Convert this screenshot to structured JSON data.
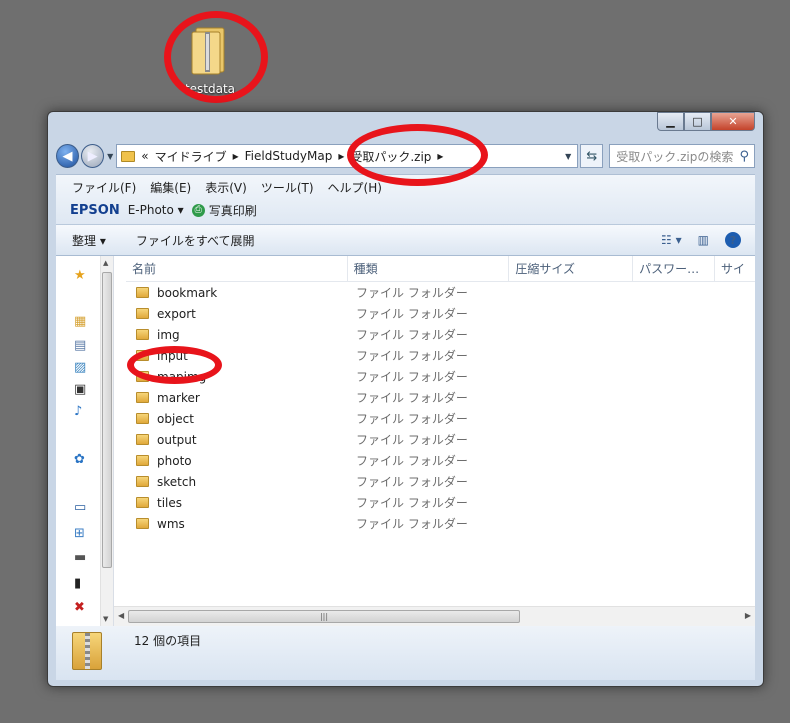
{
  "desktop": {
    "icon_label": "testdata"
  },
  "window": {
    "caption": {
      "minimize": "▁",
      "maximize": "□",
      "close": "✕"
    },
    "address": {
      "crumbs": [
        "«",
        "マイドライブ",
        "▸",
        "FieldStudyMap",
        "▸",
        "受取パック.zip",
        "▸"
      ]
    },
    "search": {
      "placeholder": "受取パック.zipの検索"
    },
    "menu": [
      "ファイル(F)",
      "編集(E)",
      "表示(V)",
      "ツール(T)",
      "ヘルプ(H)"
    ],
    "epson": {
      "brand": "EPSON",
      "app": "E-Photo ▾",
      "print": "写真印刷"
    },
    "commands": {
      "organize": "整理 ▾",
      "expand": "ファイルをすべて展開"
    },
    "columns": [
      "名前",
      "種類",
      "圧縮サイズ",
      "パスワー…",
      "サイ"
    ],
    "files": [
      {
        "name": "bookmark",
        "type": "ファイル フォルダー"
      },
      {
        "name": "export",
        "type": "ファイル フォルダー"
      },
      {
        "name": "img",
        "type": "ファイル フォルダー"
      },
      {
        "name": "input",
        "type": "ファイル フォルダー"
      },
      {
        "name": "mapimg",
        "type": "ファイル フォルダー"
      },
      {
        "name": "marker",
        "type": "ファイル フォルダー"
      },
      {
        "name": "object",
        "type": "ファイル フォルダー"
      },
      {
        "name": "output",
        "type": "ファイル フォルダー"
      },
      {
        "name": "photo",
        "type": "ファイル フォルダー"
      },
      {
        "name": "sketch",
        "type": "ファイル フォルダー"
      },
      {
        "name": "tiles",
        "type": "ファイル フォルダー"
      },
      {
        "name": "wms",
        "type": "ファイル フォルダー"
      }
    ],
    "status": {
      "count": "12 個の項目"
    }
  },
  "colors": {
    "annotation": "#e8141b",
    "desktop": "#6f6f6f"
  }
}
